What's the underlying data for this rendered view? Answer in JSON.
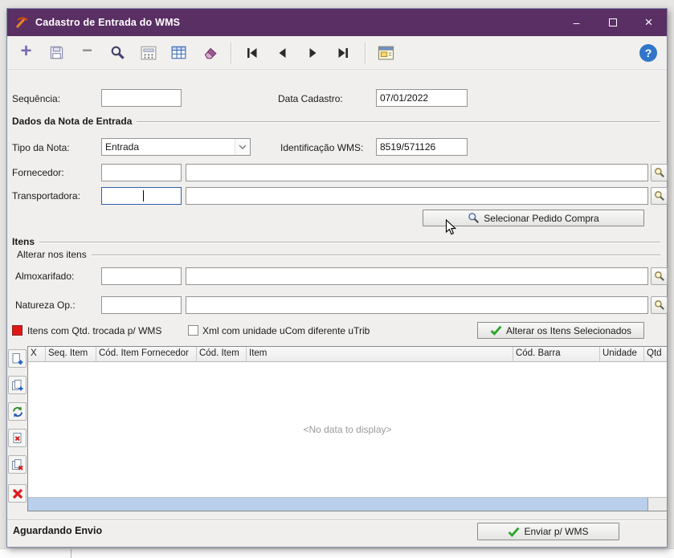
{
  "window": {
    "title": "Cadastro de Entrada do WMS",
    "controls": {
      "minimize": "–",
      "close": "×"
    }
  },
  "toolbar": {
    "help": "?"
  },
  "form": {
    "sequencia_label": "Sequência:",
    "sequencia_value": "",
    "data_cadastro_label": "Data Cadastro:",
    "data_cadastro_value": "07/01/2022",
    "nota_group_title": "Dados da Nota de Entrada",
    "tipo_nota_label": "Tipo da Nota:",
    "tipo_nota_value": "Entrada",
    "identificacao_label": "Identificação WMS:",
    "identificacao_value": "8519/571126",
    "fornecedor_label": "Fornecedor:",
    "fornecedor_code": "",
    "fornecedor_name": "",
    "transportadora_label": "Transportadora:",
    "transportadora_code": "",
    "transportadora_name": "",
    "selecionar_pedido_label": "Selecionar Pedido Compra"
  },
  "itens": {
    "group_title": "Itens",
    "subgroup_title": "Alterar nos itens",
    "almoxarifado_label": "Almoxarifado:",
    "almoxarifado_code": "",
    "almoxarifado_name": "",
    "natureza_label": "Natureza Op.:",
    "natureza_code": "",
    "natureza_name": "",
    "legend_label": "Itens com Qtd. trocada p/ WMS",
    "checkbox_label": "Xml com unidade uCom diferente uTrib",
    "alterar_button_label": "Alterar os Itens Selecionados"
  },
  "grid": {
    "columns": [
      "X",
      "Seq. Item",
      "Cód. Item Fornecedor",
      "Cód. Item",
      "Item",
      "Cód. Barra",
      "Unidade",
      "Qtd"
    ],
    "empty_text": "<No data to display>"
  },
  "statusbar": {
    "status_text": "Aguardando Envio",
    "enviar_button_label": "Enviar p/ WMS"
  },
  "colors": {
    "titlebar": "#5a2f63",
    "legend_red": "#e31616",
    "check_green": "#2da32d",
    "scrollbar_blue": "#b9cfec"
  }
}
